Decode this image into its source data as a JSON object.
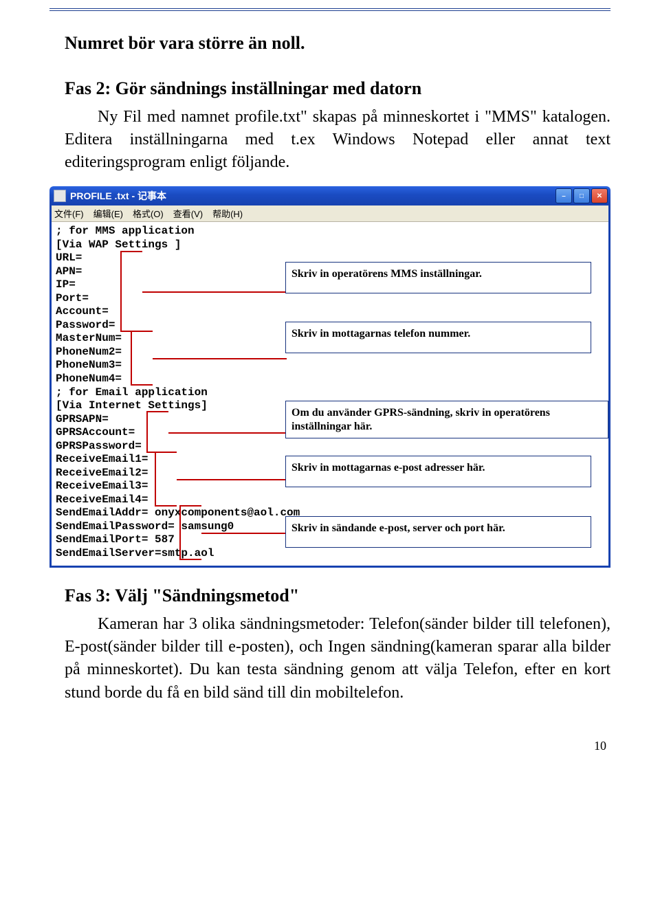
{
  "heading1": "Numret bör vara större än noll.",
  "heading2": "Fas 2: Gör sändnings inställningar med datorn",
  "para1": "Ny Fil med namnet profile.txt\" skapas på minneskortet i \"MMS\" katalogen. Editera inställningarna med t.ex Windows Notepad eller annat text editeringsprogram enligt följande.",
  "notepad": {
    "title": "PROFILE .txt - 记事本",
    "menu": [
      "文件(F)",
      "编辑(E)",
      "格式(O)",
      "查看(V)",
      "帮助(H)"
    ],
    "lines": [
      "; for MMS application",
      "[Via WAP Settings ]",
      "URL=",
      "APN=",
      "IP=",
      "Port=",
      "Account=",
      "Password=",
      "MasterNum=",
      "PhoneNum2=",
      "PhoneNum3=",
      "PhoneNum4=",
      "; for Email application",
      "[Via Internet Settings]",
      "GPRSAPN=",
      "GPRSAccount=",
      "GPRSPassword=",
      "ReceiveEmail1=",
      "ReceiveEmail2=",
      "ReceiveEmail3=",
      "ReceiveEmail4=",
      "SendEmailAddr= onyxcomponents@aol.com",
      "SendEmailPassword= samsung0",
      "SendEmailPort= 587",
      "SendEmailServer=smtp.aol"
    ]
  },
  "annotations": {
    "a1": "Skriv in operatörens MMS inställningar.",
    "a2": "Skriv in mottagarnas telefon nummer.",
    "a3": "Om du använder GPRS-sändning, skriv in operatörens inställningar här.",
    "a4": "Skriv in mottagarnas e-post adresser här.",
    "a5": "Skriv in sändande e-post, server och port här."
  },
  "heading3": "Fas 3: Välj \"Sändningsmetod\"",
  "para2": "Kameran har 3 olika sändningsmetoder: Telefon(sänder bilder till telefonen), E-post(sänder bilder till e-posten), och Ingen sändning(kameran sparar alla bilder på minneskortet). Du kan testa sändning genom att välja Telefon, efter en kort stund borde du få en bild sänd till din mobiltelefon.",
  "page_number": "10"
}
